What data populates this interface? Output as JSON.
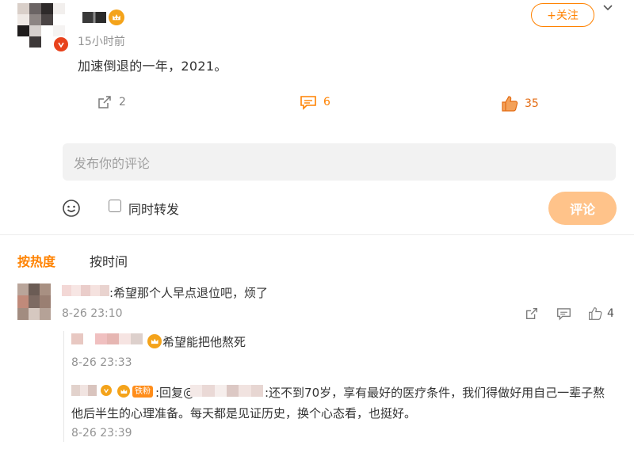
{
  "post": {
    "time": "15小时前",
    "text": "加速倒退的一年，2021。",
    "follow_label": "+关注",
    "repost_count": "2",
    "comment_count": "6",
    "like_count": "35"
  },
  "composer": {
    "placeholder": "发布你的评论",
    "repost_checkbox_label": "同时转发",
    "submit_label": "评论"
  },
  "sort_tabs": {
    "hot": "按热度",
    "time": "按时间"
  },
  "comments": [
    {
      "text": ":希望那个人早点退位吧，烦了",
      "time": "8-26 23:10",
      "like_count": "4",
      "replies": [
        {
          "text": "希望能把他熬死",
          "time": "8-26 23:33"
        },
        {
          "badge": "铁粉",
          "reply_prefix": ":回复@",
          "line1": ":还不到70岁，享有最好的医疗条件，我们得做好用自己一辈子熬",
          "line2": "他后半生的心理准备。每天都是见证历史，换个心态看，也挺好。",
          "time": "8-26 23:39"
        }
      ]
    }
  ],
  "colors": {
    "accent": "#ff8200",
    "submit_disabled": "#ffc38a",
    "muted_text": "#939393"
  },
  "icons": [
    "crown-icon",
    "verified-icon",
    "repost-icon",
    "comment-icon",
    "like-icon",
    "emoji-icon",
    "chevron-down-icon"
  ]
}
